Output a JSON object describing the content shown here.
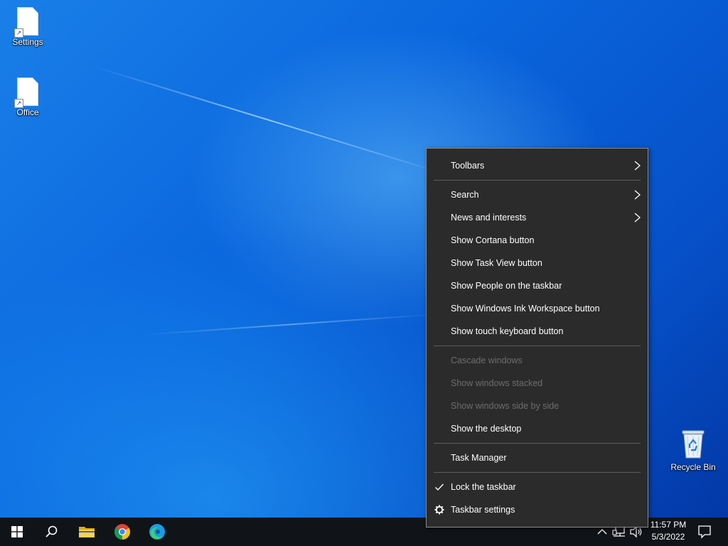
{
  "desktop": {
    "icons": [
      {
        "label": "Settings",
        "icon": "shortcut-file-icon"
      },
      {
        "label": "Office",
        "icon": "shortcut-file-icon"
      },
      {
        "label": "Recycle Bin",
        "icon": "recycle-bin-icon"
      }
    ]
  },
  "context_menu": {
    "groups": [
      [
        {
          "label": "Toolbars",
          "submenu": true
        }
      ],
      [
        {
          "label": "Search",
          "submenu": true
        },
        {
          "label": "News and interests",
          "submenu": true
        },
        {
          "label": "Show Cortana button"
        },
        {
          "label": "Show Task View button"
        },
        {
          "label": "Show People on the taskbar"
        },
        {
          "label": "Show Windows Ink Workspace button"
        },
        {
          "label": "Show touch keyboard button"
        }
      ],
      [
        {
          "label": "Cascade windows",
          "disabled": true
        },
        {
          "label": "Show windows stacked",
          "disabled": true
        },
        {
          "label": "Show windows side by side",
          "disabled": true
        },
        {
          "label": "Show the desktop"
        }
      ],
      [
        {
          "label": "Task Manager"
        }
      ],
      [
        {
          "label": "Lock the taskbar",
          "checked": true
        },
        {
          "label": "Taskbar settings",
          "icon": "gear-icon"
        }
      ]
    ]
  },
  "taskbar": {
    "pinned": [
      {
        "name": "start-button",
        "icon": "windows-logo-icon"
      },
      {
        "name": "search-button",
        "icon": "search-icon"
      },
      {
        "name": "file-explorer-button",
        "icon": "folder-icon"
      },
      {
        "name": "chrome-button",
        "icon": "chrome-icon"
      },
      {
        "name": "edge-button",
        "icon": "edge-icon"
      }
    ],
    "tray": {
      "time": "11:57 PM",
      "date": "5/3/2022"
    }
  },
  "colors": {
    "menu_bg": "#2b2b2b",
    "menu_disabled_text": "#6d6d6d",
    "taskbar_bg": "#101418",
    "desktop_blue": "#0a66dd"
  }
}
